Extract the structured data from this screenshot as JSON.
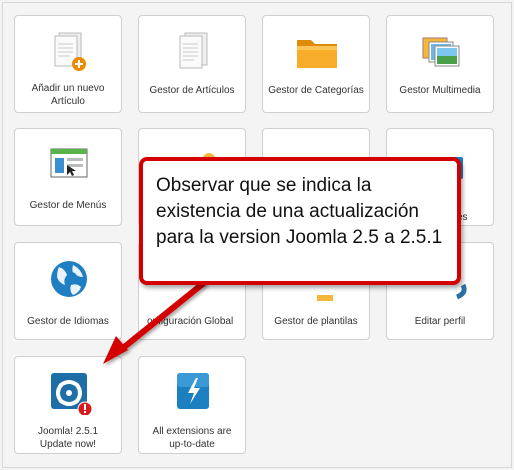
{
  "tiles": [
    {
      "id": "add-article",
      "label": "Añadir un nuevo Artículo",
      "icon": "add-article-icon"
    },
    {
      "id": "article-manager",
      "label": "Gestor de Artículos",
      "icon": "article-icon"
    },
    {
      "id": "category-manager",
      "label": "Gestor de Categorías",
      "icon": "folder-icon"
    },
    {
      "id": "media-manager",
      "label": "Gestor Multimedia",
      "icon": "media-icon"
    },
    {
      "id": "menu-manager",
      "label": "Gestor de Menús",
      "icon": "menu-icon"
    },
    {
      "id": "user-manager",
      "label": "",
      "icon": "user-icon"
    },
    {
      "id": "module-manager",
      "label": "",
      "icon": "module-icon"
    },
    {
      "id": "extension-manager",
      "label_tail": "es",
      "icon": "extensions-icon"
    },
    {
      "id": "language-manager",
      "label": "Gestor de Idiomas",
      "icon": "globe-icon"
    },
    {
      "id": "global-config",
      "label": "onfiguración Global",
      "icon": "config-icon"
    },
    {
      "id": "template-manager",
      "label": "Gestor de plantilas",
      "icon": "template-icon"
    },
    {
      "id": "edit-profile",
      "label": "Editar perfil",
      "icon": "profile-icon"
    },
    {
      "id": "joomla-update",
      "label_line1": "Joomla! 2.5.1",
      "label_line2": "Update now!",
      "icon": "joomla-update-icon"
    },
    {
      "id": "extensions-uptodate",
      "label_line1": "All extensions are",
      "label_line2": "up-to-date",
      "icon": "lightning-icon"
    }
  ],
  "add_article_line1": "Añadir un nuevo",
  "add_article_line2": "Artículo",
  "callout": {
    "text": "Observar que se indica la existencia de una actualización para la version Joomla 2.5 a 2.5.1"
  },
  "colors": {
    "callout_border": "#d40000",
    "folder": "#f3a21a",
    "joomla_blue": "#1e6ea8",
    "lightning_blue": "#1b7fc0",
    "badge_red": "#d91b1b"
  }
}
